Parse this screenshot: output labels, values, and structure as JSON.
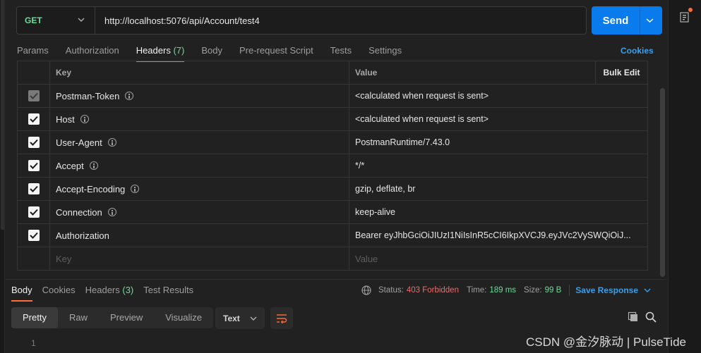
{
  "request": {
    "method": "GET",
    "url": "http://localhost:5076/api/Account/test4",
    "send_label": "Send"
  },
  "request_tabs": [
    {
      "label": "Params",
      "count": ""
    },
    {
      "label": "Authorization",
      "count": ""
    },
    {
      "label": "Headers",
      "count": "(7)"
    },
    {
      "label": "Body",
      "count": ""
    },
    {
      "label": "Pre-request Script",
      "count": ""
    },
    {
      "label": "Tests",
      "count": ""
    },
    {
      "label": "Settings",
      "count": ""
    }
  ],
  "cookies_label": "Cookies",
  "headers_table": {
    "col_key": "Key",
    "col_value": "Value",
    "bulk_edit": "Bulk Edit",
    "rows": [
      {
        "key": "Postman-Token",
        "value": "<calculated when request is sent>"
      },
      {
        "key": "Host",
        "value": "<calculated when request is sent>"
      },
      {
        "key": "User-Agent",
        "value": "PostmanRuntime/7.43.0"
      },
      {
        "key": "Accept",
        "value": "*/*"
      },
      {
        "key": "Accept-Encoding",
        "value": "gzip, deflate, br"
      },
      {
        "key": "Connection",
        "value": "keep-alive"
      },
      {
        "key": "Authorization",
        "value": "Bearer eyJhbGciOiJIUzI1NiIsInR5cCI6IkpXVCJ9.eyJVc2VySWQiOiJ..."
      }
    ],
    "placeholder_key": "Key",
    "placeholder_value": "Value"
  },
  "response_tabs": [
    {
      "label": "Body",
      "count": ""
    },
    {
      "label": "Cookies",
      "count": ""
    },
    {
      "label": "Headers",
      "count": "(3)"
    },
    {
      "label": "Test Results",
      "count": ""
    }
  ],
  "response_status": {
    "status_label": "Status:",
    "status_value": "403 Forbidden",
    "time_label": "Time:",
    "time_value": "189 ms",
    "size_label": "Size:",
    "size_value": "99 B",
    "save_response": "Save Response"
  },
  "view_tabs": [
    "Pretty",
    "Raw",
    "Preview",
    "Visualize"
  ],
  "format_select": "Text",
  "line_number": "1",
  "watermark": "CSDN @金汐脉动 | PulseTide",
  "colors": {
    "accent_orange": "#ff6c37",
    "send_blue": "#097bed",
    "method_green": "#6bdd9a",
    "status_red": "#eb6b6b",
    "link_blue": "#3d9ee8"
  }
}
